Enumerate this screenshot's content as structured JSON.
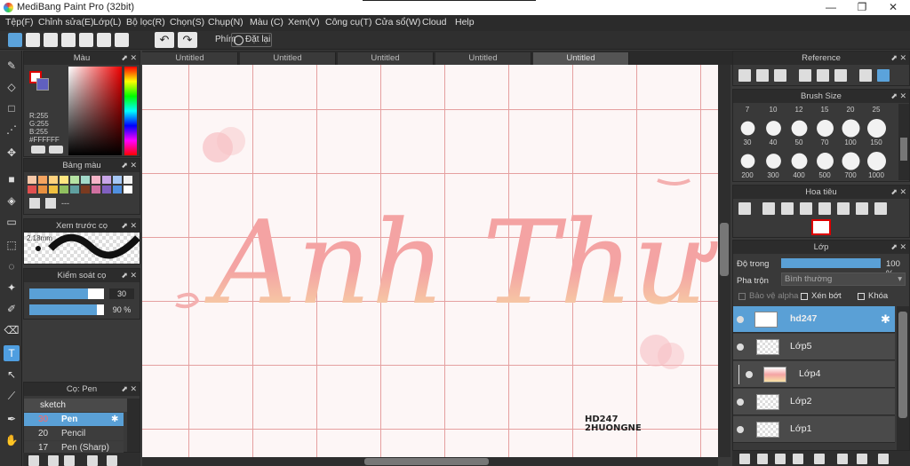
{
  "app": {
    "title": "MediBang Paint Pro (32bit)",
    "minimize": "—",
    "maximize": "❐",
    "close": "✕"
  },
  "menu": [
    "Tệp(F)",
    "Chỉnh sửa(E)",
    "Lớp(L)",
    "Bộ lọc(R)",
    "Chọn(S)",
    "Chụp(N)",
    "Màu (C)",
    "Xem(V)",
    "Công cụ(T)",
    "Cửa sổ(W)",
    "Cloud",
    "Help"
  ],
  "toolbar": {
    "phim_label": "Phím",
    "reset_label": "Đặt lại"
  },
  "tabs": [
    "Untitled",
    "Untitled",
    "Untitled",
    "Untitled",
    "Untitled"
  ],
  "color_panel": {
    "title": "Màu",
    "r": "R:255",
    "g": "G:255",
    "b": "B:255",
    "hex": "#FFFFFF"
  },
  "palette_panel": {
    "title": "Bảng màu",
    "empty": "---",
    "swatches": [
      "#f7c8a8",
      "#f4a460",
      "#ffd27f",
      "#ffe680",
      "#b6e3a3",
      "#a3d9c9",
      "#f5b5c8",
      "#c9a6e8",
      "#a6c8f5",
      "#f0f0f0",
      "#e05050",
      "#e89040",
      "#f0c040",
      "#90c060",
      "#60a0a0",
      "#7a3a20",
      "#d070a0",
      "#8060c0",
      "#5090e0",
      "#ffffff"
    ]
  },
  "brush_preview_panel": {
    "title": "Xem trước cọ",
    "size_label": "2.18mm"
  },
  "brush_control_panel": {
    "title": "Kiểm soát cọ",
    "size_value": "30",
    "opacity_value": "90 %",
    "size_fraction": 0.78,
    "opacity_fraction": 0.9
  },
  "brush_panel": {
    "title": "Cọ: Pen",
    "group": "sketch",
    "items": [
      {
        "size": "30",
        "name": "Pen"
      },
      {
        "size": "20",
        "name": "Pencil"
      },
      {
        "size": "17",
        "name": "Pen (Sharp)"
      }
    ]
  },
  "canvas": {
    "main_text": "Anh Thư",
    "watermark_line1": "HD247",
    "watermark_line2": "2HUONGNE"
  },
  "reference_panel": {
    "title": "Reference"
  },
  "brush_size_panel": {
    "title": "Brush Size",
    "top_labels": [
      "7",
      "10",
      "12",
      "15",
      "20",
      "25"
    ],
    "row1": [
      "30",
      "40",
      "50",
      "70",
      "100",
      "150"
    ],
    "row2": [
      "200",
      "300",
      "400",
      "500",
      "700",
      "1000"
    ]
  },
  "navigator_panel": {
    "title": "Hoa tiêu"
  },
  "layer_panel": {
    "title": "Lớp",
    "opacity_label": "Độ trong",
    "opacity_value": "100 %",
    "opacity_fraction": 1.0,
    "blend_label": "Pha trộn",
    "blend_value": "Bình thường",
    "protect_alpha": "Bảo vệ alpha",
    "clipping": "Xén bớt",
    "lock": "Khóa",
    "layers": [
      "hd247",
      "Lớp5",
      "Lớp4",
      "Lớp2",
      "Lớp1"
    ]
  },
  "colors": {
    "accent": "#4f9ee0",
    "canvas_bg": "#fdf6f6",
    "grid": "#e5a0a0",
    "lettering": "#f4a3a3"
  }
}
